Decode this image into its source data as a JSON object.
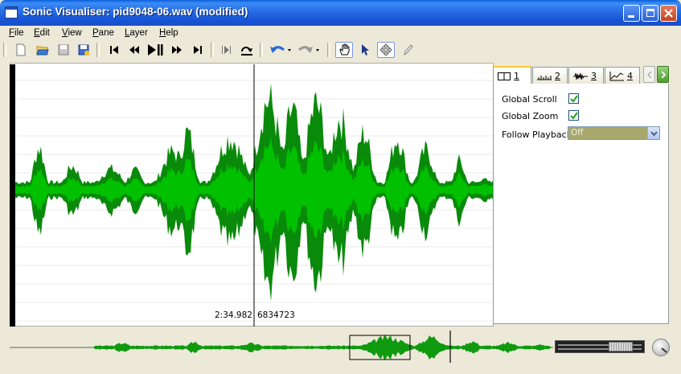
{
  "window": {
    "title": "Sonic Visualiser: pid9048-06.wav (modified)"
  },
  "menu": [
    {
      "first": "F",
      "rest": "ile"
    },
    {
      "first": "E",
      "rest": "dit"
    },
    {
      "first": "V",
      "rest": "iew"
    },
    {
      "first": "P",
      "rest": "ane"
    },
    {
      "first": "L",
      "rest": "ayer"
    },
    {
      "first": "H",
      "rest": "elp"
    }
  ],
  "toolbar_icons": [
    "new-file-icon",
    "open-folder-icon",
    "save-icon",
    "save-as-icon",
    "rewind-start-icon",
    "rewind-icon",
    "play-pause-icon",
    "fast-forward-icon",
    "forward-end-icon",
    "play-selection-icon",
    "loop-icon",
    "undo-icon",
    "redo-icon",
    "navigate-hand-icon",
    "select-arrow-icon",
    "move-icon",
    "draw-pencil-icon"
  ],
  "pane": {
    "time_readout": "2:34.982",
    "frame_readout": "6834723",
    "waveform_color": "#0a8a0a",
    "waveform_rms_color": "#00c000"
  },
  "property_tabs": [
    {
      "num": "1",
      "icon": "pane-layout-icon"
    },
    {
      "num": "2",
      "icon": "ruler-icon"
    },
    {
      "num": "3",
      "icon": "waveform-icon"
    },
    {
      "num": "4",
      "icon": "chart-line-icon"
    }
  ],
  "properties": {
    "global_scroll_label": "Global Scroll",
    "global_scroll_checked": true,
    "global_zoom_label": "Global Zoom",
    "global_zoom_checked": true,
    "follow_playback_label": "Follow Playback",
    "follow_playback_value": "Off"
  }
}
